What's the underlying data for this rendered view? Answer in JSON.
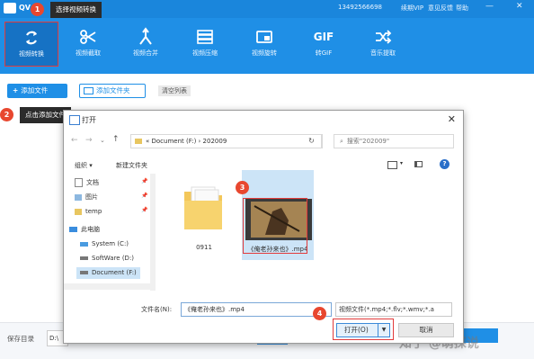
{
  "app": {
    "title_short": "QV",
    "account": "13492566698",
    "links": [
      "续期VIP",
      "意见反馈",
      "帮助"
    ],
    "tools": [
      {
        "label": "视频转换",
        "icon": "refresh-arrows-icon"
      },
      {
        "label": "视频截取",
        "icon": "scissors-icon"
      },
      {
        "label": "视频合并",
        "icon": "merge-arrow-icon"
      },
      {
        "label": "视频压缩",
        "icon": "compress-icon"
      },
      {
        "label": "视频旋转",
        "icon": "rotate-screen-icon"
      },
      {
        "label": "转GIF",
        "icon": "gif-icon"
      },
      {
        "label": "音乐提取",
        "icon": "shuffle-icon"
      }
    ]
  },
  "toolbar": {
    "add_file": "添加文件",
    "add_folder": "添加文件夹",
    "clear_list": "清空列表"
  },
  "callouts": {
    "c1_num": "1",
    "c1_text": "选择视频转换",
    "c2_num": "2",
    "c2_text": "点击添加文件",
    "c3_num": "3",
    "c4_num": "4"
  },
  "dialog": {
    "title": "打开",
    "breadcrumb": "«  Document (F:)  ›  202009",
    "search_placeholder": "搜索\"202009\"",
    "organize": "组织 ▾",
    "new_folder": "新建文件夹",
    "nav_items": [
      {
        "label": "文档",
        "icon": "document-icon"
      },
      {
        "label": "图片",
        "icon": "picture-icon"
      },
      {
        "label": "temp",
        "icon": "folder-icon"
      },
      {
        "label": "此电脑",
        "icon": "computer-icon"
      },
      {
        "label": "System (C:)",
        "icon": "windows-drive-icon"
      },
      {
        "label": "SoftWare (D:)",
        "icon": "drive-icon"
      },
      {
        "label": "Document (F:)",
        "icon": "drive-icon"
      }
    ],
    "files": [
      {
        "name": "0911",
        "type": "folder"
      },
      {
        "name": "《俺老孙来也》.mp4",
        "type": "video"
      }
    ],
    "file_name_label": "文件名(N):",
    "file_name_value": "《俺老孙来也》.mp4",
    "file_type_value": "视频文件(*.mp4;*.flv;*.wmv;*.a",
    "open_label": "打开(O)",
    "cancel_label": "取消"
  },
  "bottom": {
    "save_dir_label": "保存目录",
    "save_dir_value": "D:\\"
  },
  "watermark": "知乎 @萌探说",
  "colors": {
    "brand": "#1f8fe6",
    "callout": "#e8472f",
    "highlight": "#cce4f7"
  }
}
